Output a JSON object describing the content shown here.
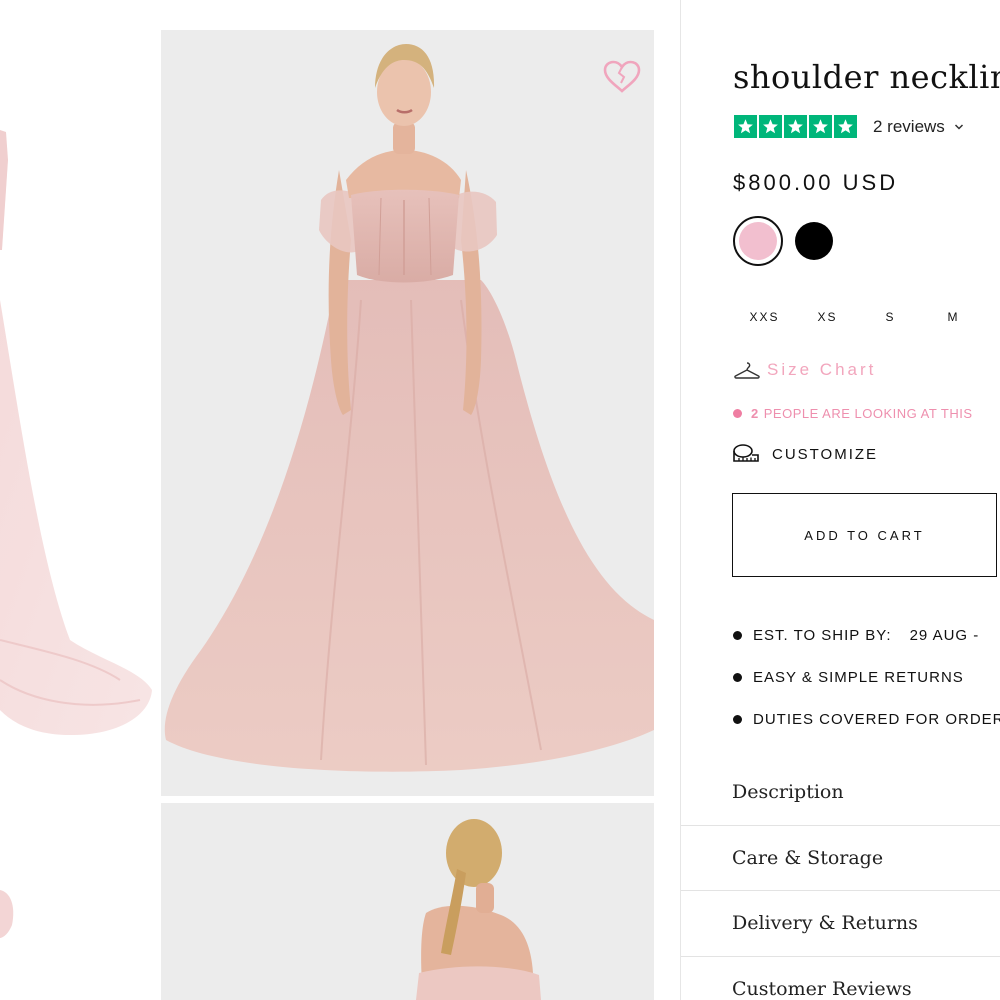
{
  "product": {
    "title": "shoulder necklin",
    "reviews_label": "2 reviews",
    "rating_stars": 5,
    "price": "$800.00 USD"
  },
  "colors": {
    "trustpilot_green": "#00b67a",
    "accent_pink": "#f2a6bd",
    "swatch_pink": "#f2bfcf",
    "swatch_black": "#000000",
    "dress_pink": "#e9c3bd"
  },
  "swatches": [
    {
      "name": "pink",
      "selected": true
    },
    {
      "name": "black",
      "selected": false
    }
  ],
  "sizes": [
    "XXS",
    "XS",
    "S",
    "M"
  ],
  "size_chart": {
    "label": "Size Chart",
    "icon": "hanger-icon"
  },
  "watchers": {
    "count": "2",
    "text": "PEOPLE ARE LOOKING AT THIS"
  },
  "customize": {
    "label": "CUSTOMIZE",
    "icon": "measuring-tape-icon"
  },
  "cart": {
    "button_label": "ADD TO CART"
  },
  "perks": [
    {
      "label": "EST. TO SHIP BY:",
      "value": "29 AUG -"
    },
    {
      "label": "EASY & SIMPLE RETURNS"
    },
    {
      "label": "DUTIES COVERED FOR ORDER"
    }
  ],
  "accordion": [
    "Description",
    "Care & Storage",
    "Delivery & Returns",
    "Customer Reviews"
  ],
  "gallery": {
    "wishlist_icon": "heart-icon"
  }
}
